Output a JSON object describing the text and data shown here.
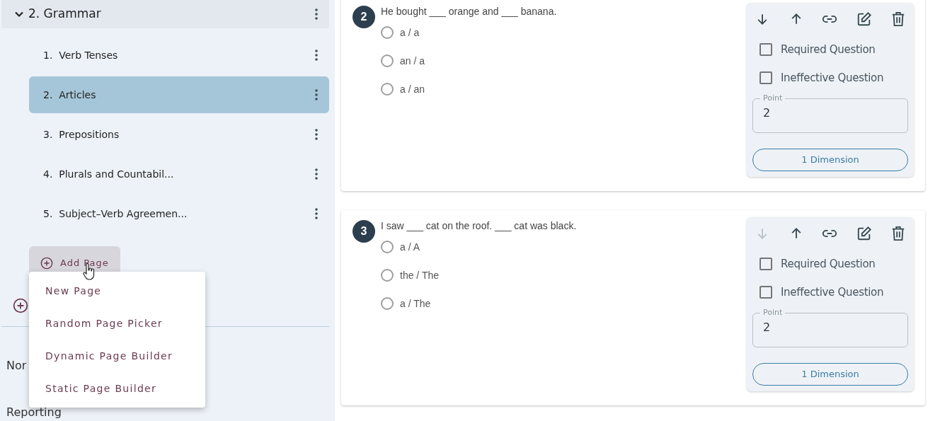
{
  "sidebar": {
    "section": {
      "label": "2. Grammar",
      "expanded": true,
      "children": [
        {
          "number": "1.",
          "label": "Verb Tenses",
          "selected": false
        },
        {
          "number": "2.",
          "label": "Articles",
          "selected": true
        },
        {
          "number": "3.",
          "label": "Prepositions",
          "selected": false
        },
        {
          "number": "4.",
          "label": "Plurals and Countabil...",
          "selected": false
        },
        {
          "number": "5.",
          "label": "Subject–Verb Agreemen...",
          "selected": false
        }
      ]
    },
    "add_page_button": "Add Page",
    "add_page_menu": [
      "New Page",
      "Random Page Picker",
      "Dynamic Page Builder",
      "Static Page Builder"
    ],
    "nav_items": [
      "Nor",
      "Reporting"
    ]
  },
  "questions": [
    {
      "number": "2",
      "text": "He bought ___ orange and ___ banana.",
      "options": [
        {
          "label": "a / a",
          "selected": false
        },
        {
          "label": "an / a",
          "selected": false
        },
        {
          "label": "a / an",
          "selected": false
        }
      ],
      "move_down_disabled": false,
      "required_label": "Required Question",
      "required": false,
      "ineffective_label": "Ineffective Question",
      "ineffective": false,
      "point_label": "Point",
      "point": "2",
      "dimension_button": "1 Dimension"
    },
    {
      "number": "3",
      "text": "I saw ___ cat on the roof. ___ cat was black.",
      "options": [
        {
          "label": "a / A",
          "selected": false
        },
        {
          "label": "the / The",
          "selected": false
        },
        {
          "label": "a / The",
          "selected": false
        }
      ],
      "move_down_disabled": true,
      "required_label": "Required Question",
      "required": false,
      "ineffective_label": "Ineffective Question",
      "ineffective": false,
      "point_label": "Point",
      "point": "2",
      "dimension_button": "1 Dimension"
    }
  ]
}
